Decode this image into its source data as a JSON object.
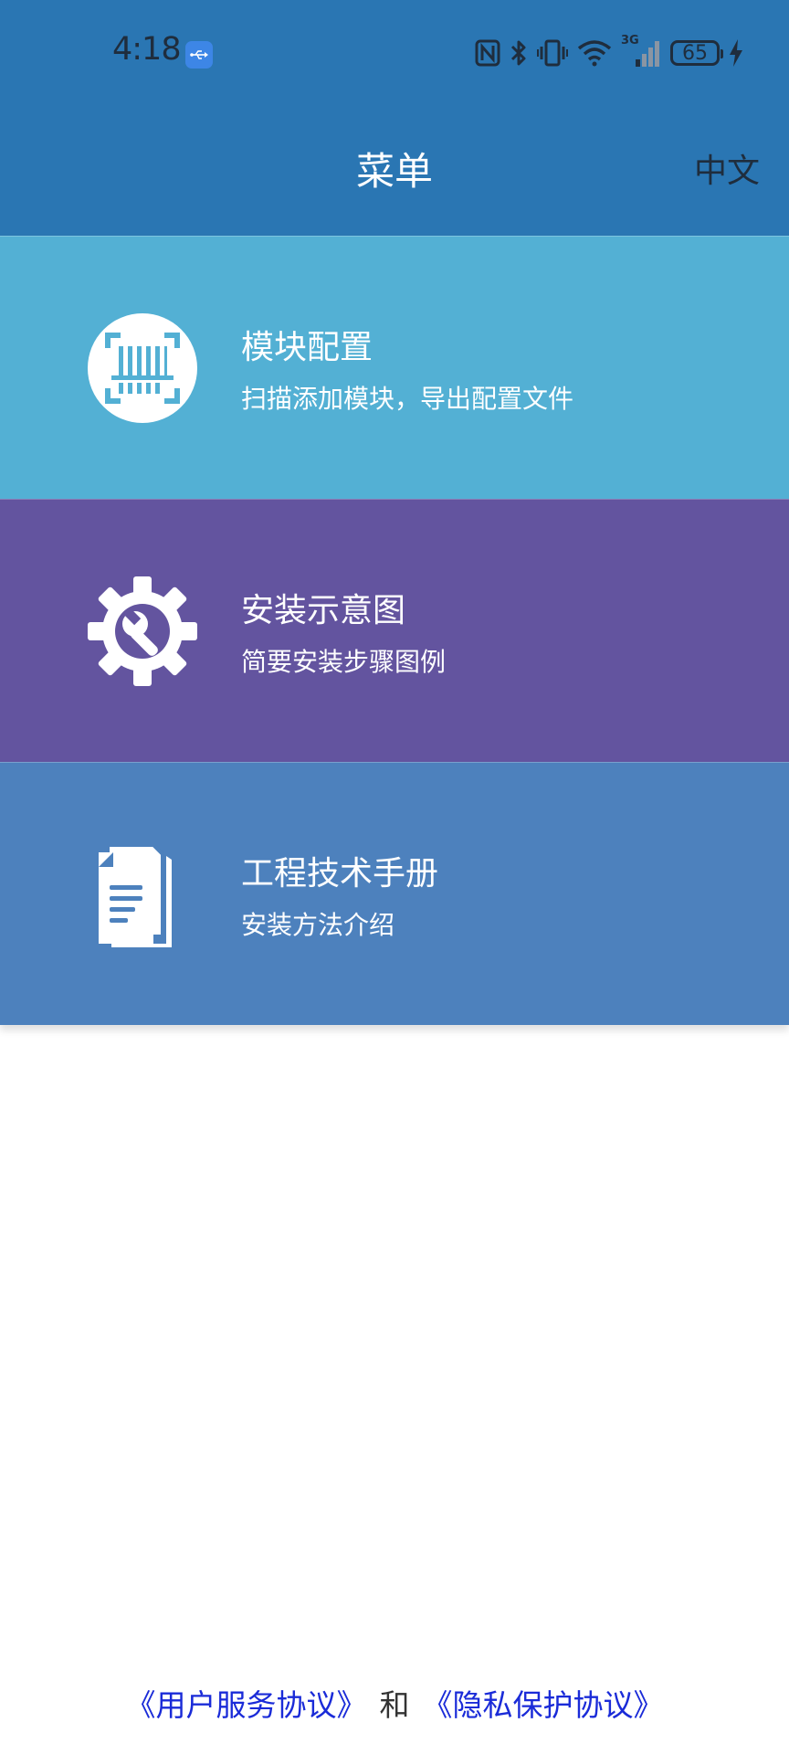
{
  "colors": {
    "header": "#2a76b3",
    "card_module": "#53b0d4",
    "card_install": "#63549f",
    "card_manual": "#4d81bd",
    "link": "#1a2bd8"
  },
  "status_bar": {
    "time": "4:18",
    "network": "3G",
    "battery": "65",
    "icons": [
      "usb-icon",
      "nfc-icon",
      "bluetooth-icon",
      "vibrate-icon",
      "wifi-icon",
      "signal-icon",
      "battery-icon",
      "charging-icon"
    ]
  },
  "header": {
    "title": "菜单",
    "language": "中文"
  },
  "menu": {
    "items": [
      {
        "title": "模块配置",
        "subtitle": "扫描添加模块，导出配置文件",
        "icon": "barcode-scan-icon"
      },
      {
        "title": "安装示意图",
        "subtitle": "简要安装步骤图例",
        "icon": "gear-wrench-icon"
      },
      {
        "title": "工程技术手册",
        "subtitle": "安装方法介绍",
        "icon": "document-icon"
      }
    ]
  },
  "footer": {
    "user_agreement": "《用户服务协议》",
    "conjunction": "和",
    "privacy_agreement": "《隐私保护协议》"
  }
}
